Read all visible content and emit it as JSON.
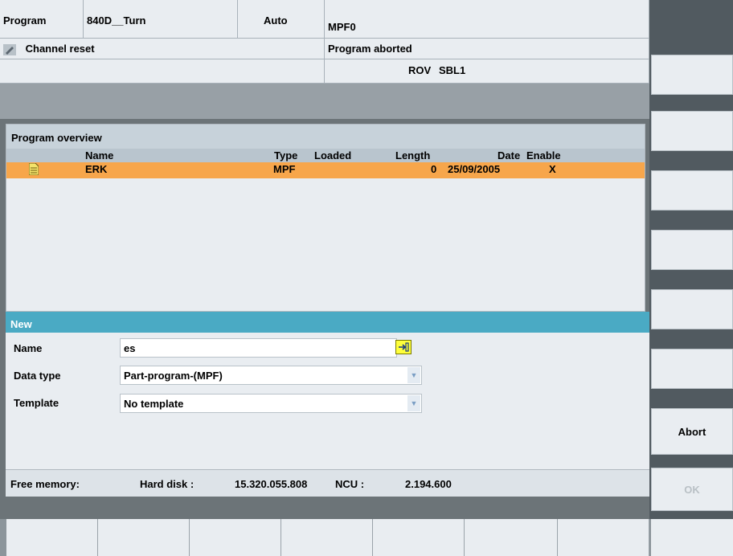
{
  "header": {
    "area": "Program",
    "machine": "840D__Turn",
    "mode": "Auto",
    "program_name": "MPF0",
    "channel_status": "Channel reset",
    "program_status": "Program aborted",
    "flags": [
      "ROV",
      "SBL1"
    ]
  },
  "overview": {
    "title": "Program overview",
    "columns": {
      "name": "Name",
      "type": "Type",
      "loaded": "Loaded",
      "length": "Length",
      "date": "Date",
      "enable": "Enable"
    },
    "rows": [
      {
        "name": "ERK",
        "type": "MPF",
        "loaded": "",
        "length": "0",
        "date": "25/09/2005",
        "enable": "X",
        "icon": "document-icon",
        "selected": true
      }
    ]
  },
  "new_dialog": {
    "title": "New",
    "name_label": "Name",
    "name_value": "es",
    "datatype_label": "Data type",
    "datatype_value": "Part-program-(MPF)",
    "template_label": "Template",
    "template_value": "No template"
  },
  "memory": {
    "label": "Free memory:",
    "hard_disk_label": "Hard disk :",
    "hard_disk_value": "15.320.055.808",
    "ncu_label": "NCU :",
    "ncu_value": "2.194.600"
  },
  "vertical_softkeys": [
    "",
    "",
    "",
    "",
    "",
    "",
    "Abort",
    "OK"
  ],
  "horizontal_softkeys": [
    "",
    "",
    "",
    "",
    "",
    "",
    ""
  ],
  "colors": {
    "selection": "#f7a64b",
    "dialog_title": "#4aaac4",
    "panel": "#e9edf1",
    "screen_bg": "#6c7478"
  }
}
